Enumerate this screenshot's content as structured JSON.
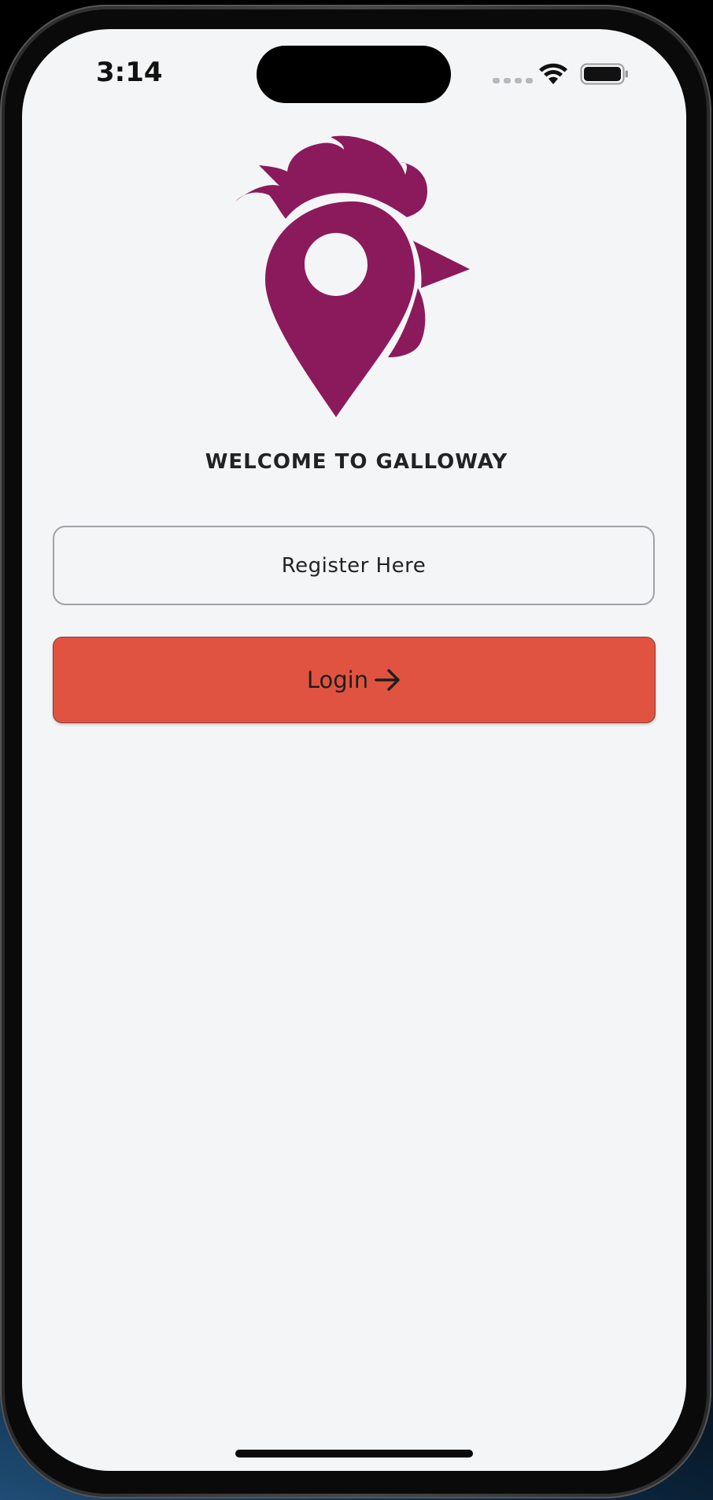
{
  "status_bar": {
    "time": "3:14",
    "icons": [
      "cellular-signal-icon",
      "wifi-icon",
      "battery-icon"
    ]
  },
  "logo": {
    "icon": "rooster-location-pin-icon",
    "color": "#8b1a5c"
  },
  "welcome": {
    "title": "WELCOME TO GALLOWAY"
  },
  "actions": {
    "register_label": "Register Here",
    "login_label": "Login",
    "login_icon": "arrow-right-icon"
  },
  "colors": {
    "background": "#f4f5f7",
    "login_button": "#e15341",
    "brand": "#8b1a5c",
    "text": "#222222"
  }
}
